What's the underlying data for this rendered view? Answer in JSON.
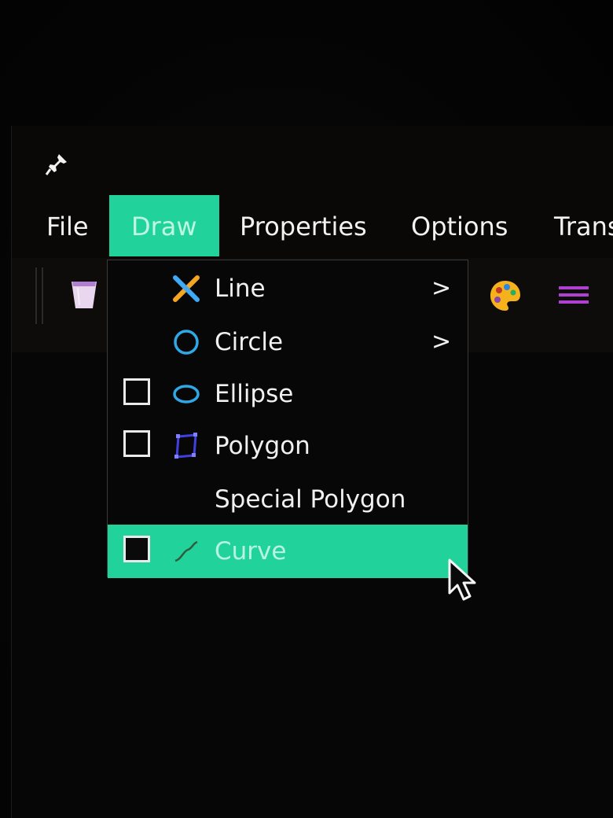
{
  "menubar": {
    "items": [
      "File",
      "Draw",
      "Properties",
      "Options",
      "Trans"
    ]
  },
  "draw_menu": {
    "items": [
      {
        "label": "Line",
        "icon": "line-tool-icon",
        "submenu_arrow": ">"
      },
      {
        "label": "Circle",
        "icon": "circle-icon",
        "submenu_arrow": ">"
      },
      {
        "label": "Ellipse",
        "icon": "ellipse-icon",
        "checkbox": "unchecked"
      },
      {
        "label": "Polygon",
        "icon": "polygon-icon",
        "checkbox": "unchecked"
      },
      {
        "label": "Special Polygon"
      },
      {
        "label": "Curve",
        "icon": "curve-icon",
        "checkbox": "unchecked",
        "highlighted": true
      }
    ]
  },
  "toolbar": {
    "icons": [
      "cup-icon",
      "palette-icon",
      "lines-icon"
    ]
  },
  "colors": {
    "accent": "#21d39b",
    "background": "#060606",
    "text": "#f0f0f0"
  }
}
